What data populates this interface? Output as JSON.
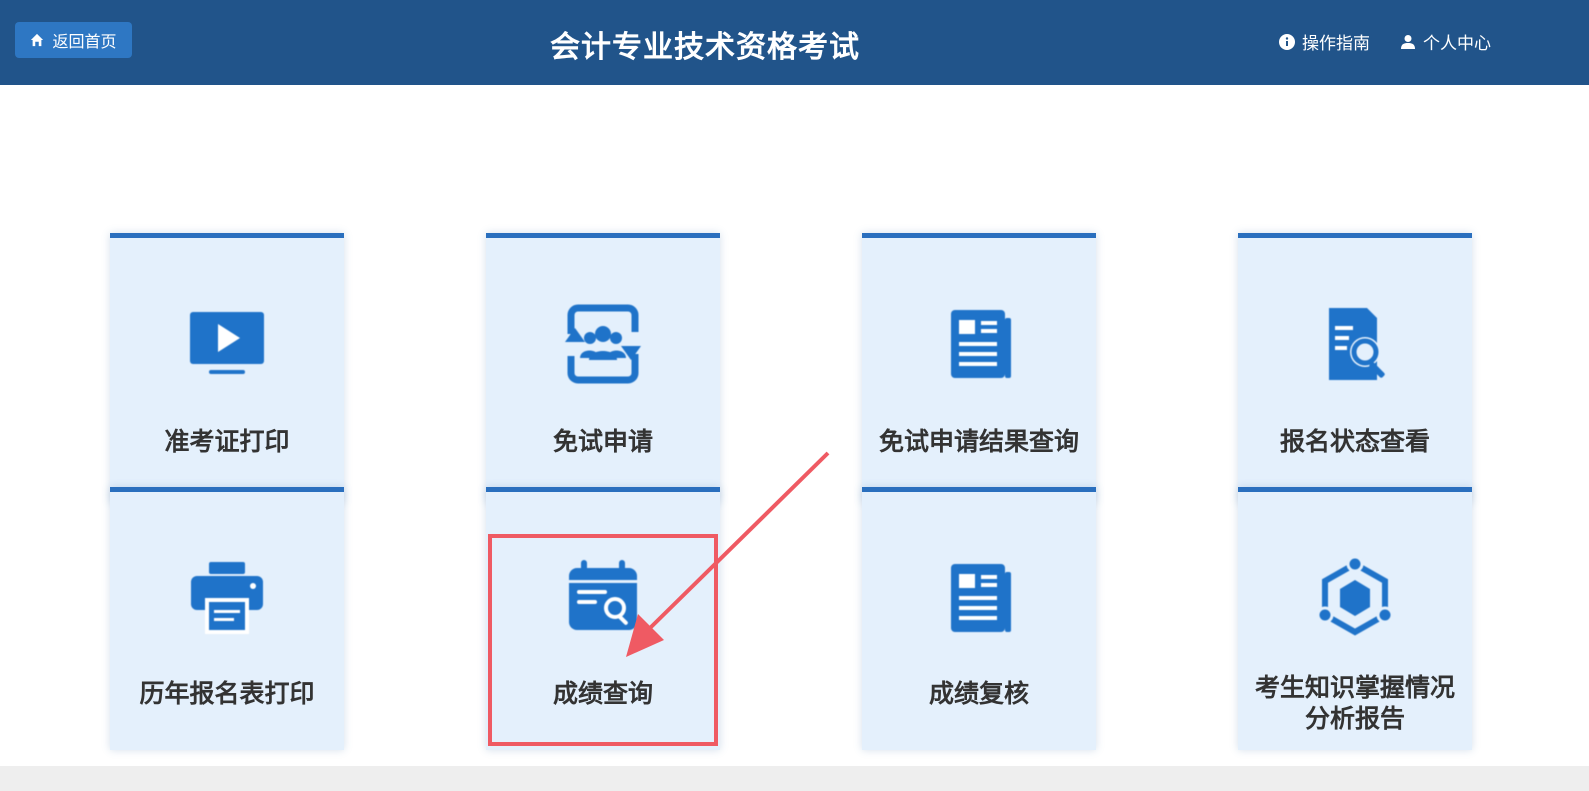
{
  "header": {
    "home_label": "返回首页",
    "title": "会计专业技术资格考试",
    "guide_label": "操作指南",
    "user_label": "个人中心",
    "bg_color": "#21548a"
  },
  "cards": [
    {
      "label": "准考证打印",
      "icon": "monitor-play-icon"
    },
    {
      "label": "免试申请",
      "icon": "user-group-exchange-icon"
    },
    {
      "label": "免试申请结果查询",
      "icon": "newspaper-icon"
    },
    {
      "label": "报名状态查看",
      "icon": "document-search-icon"
    },
    {
      "label": "历年报名表打印",
      "icon": "printer-icon"
    },
    {
      "label": "成绩查询",
      "icon": "calendar-search-icon"
    },
    {
      "label": "成绩复核",
      "icon": "newspaper-icon"
    },
    {
      "label": "考生知识掌握情况分析报告",
      "icon": "hexagon-network-icon"
    }
  ],
  "annotation": {
    "color": "#ef5a63",
    "target": "成绩查询"
  }
}
